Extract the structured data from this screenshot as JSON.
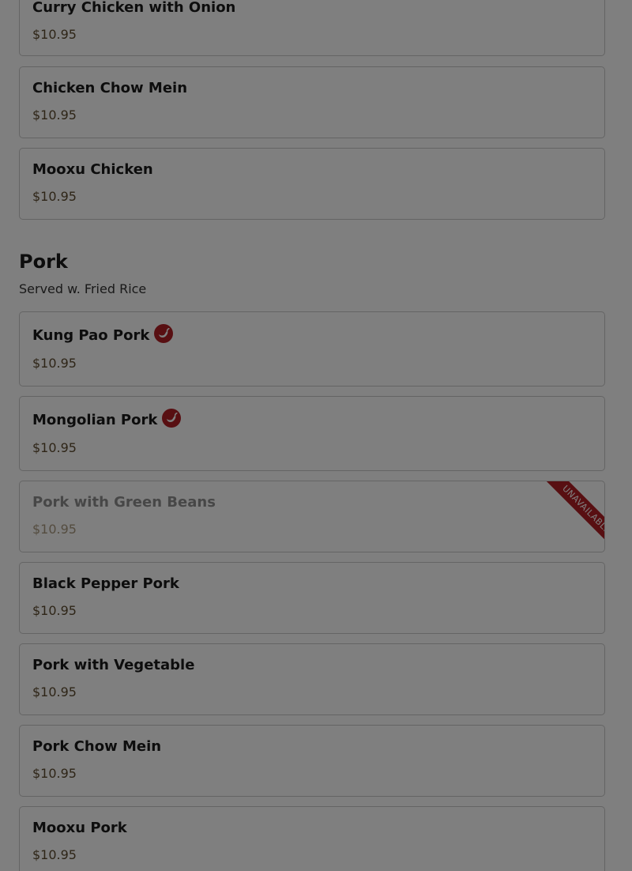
{
  "menu": {
    "items_above": [
      {
        "name": "Curry Chicken with Onion",
        "price": "$10.95"
      },
      {
        "name": "Chicken Chow Mein",
        "price": "$10.95"
      },
      {
        "name": "Mooxu Chicken",
        "price": "$10.95"
      }
    ],
    "pork": {
      "heading": "Pork",
      "subtitle": "Served w. Fried Rice",
      "items": [
        {
          "name": "Kung Pao Pork",
          "price": "$10.95",
          "spicy": true
        },
        {
          "name": "Mongolian Pork",
          "price": "$10.95",
          "spicy": true
        },
        {
          "name": "Pork with Green Beans",
          "price": "$10.95",
          "unavailable": true,
          "badge": "UNAVAILABLE"
        },
        {
          "name": "Black Pepper Pork",
          "price": "$10.95"
        },
        {
          "name": "Pork with Vegetable",
          "price": "$10.95"
        },
        {
          "name": "Pork Chow Mein",
          "price": "$10.95"
        },
        {
          "name": "Mooxu Pork",
          "price": "$10.95"
        }
      ]
    }
  },
  "icons": {
    "spicy": "chili-pepper-icon"
  },
  "colors": {
    "accent": "#b01e24",
    "price": "#5c4a2e",
    "overlay": "rgba(0,0,0,0.5)"
  }
}
